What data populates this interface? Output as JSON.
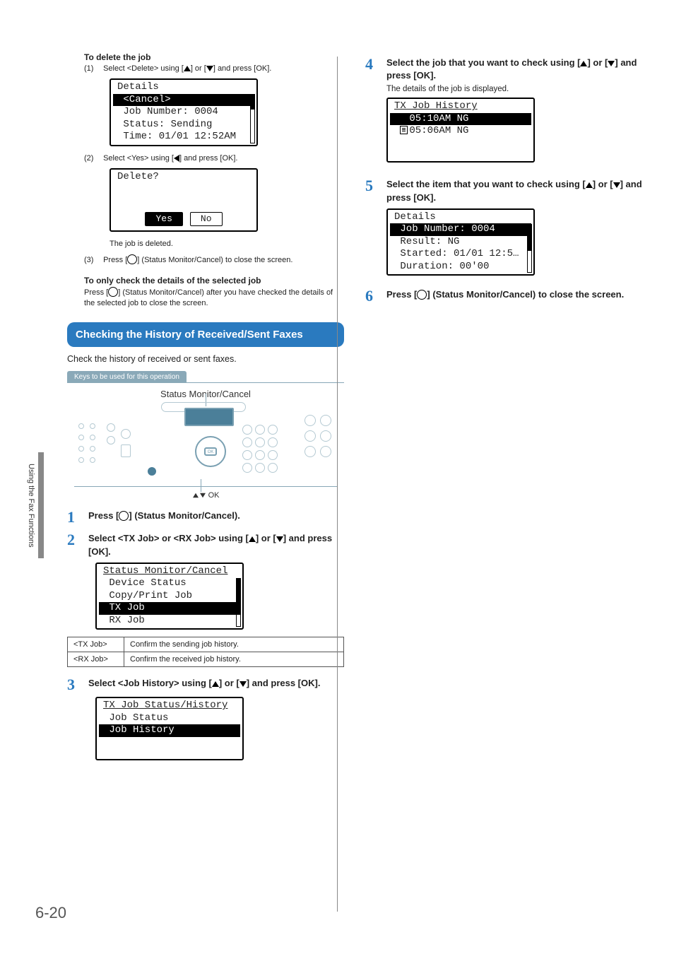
{
  "side_tab": "Using the Fax Functions",
  "page_number": "6-20",
  "left": {
    "delete_heading": "To delete the job",
    "step1_num": "(1)",
    "step1_text_a": "Select <Delete> using [",
    "step1_text_b": "] or [",
    "step1_text_c": "]  and press [OK].",
    "lcd1": {
      "r0": "Details",
      "r1": " <Cancel>",
      "r2": " Job Number: 0004",
      "r3": " Status: Sending",
      "r4": " Time: 01/01 12:52AM"
    },
    "step2_num": "(2)",
    "step2_text_a": "Select <Yes> using [",
    "step2_text_b": "]  and press [OK].",
    "dlg_title": "Delete?",
    "dlg_yes": "Yes",
    "dlg_no": "No",
    "job_deleted": "The job is deleted.",
    "step3_num": "(3)",
    "step3_text_a": "Press [",
    "step3_text_b": "] (Status Monitor/Cancel) to close the screen.",
    "only_check_heading": "To only check the details of the selected job",
    "only_check_body_a": "Press [",
    "only_check_body_b": "] (Status Monitor/Cancel) after you have checked the details of the selected job to close the screen.",
    "section_title": "Checking the History of Received/Sent Faxes",
    "section_note": "Check the history of received or sent faxes.",
    "keys_tag": "Keys to be used for this operation",
    "keys_title": "Status Monitor/Cancel",
    "keys_sub": "OK",
    "s1_a": "Press [",
    "s1_b": "] (Status Monitor/Cancel).",
    "s2_a": "Select <TX Job> or <RX Job> using [",
    "s2_b": "] or [",
    "s2_c": "] and press [OK].",
    "lcd_sm": {
      "r0": "Status Monitor/Cancel",
      "r1": " Device Status",
      "r2": " Copy/Print Job",
      "r3": " TX Job",
      "r4": " RX Job"
    },
    "table": {
      "r1c1": "<TX Job>",
      "r1c2": "Confirm the sending job history.",
      "r2c1": "<RX Job>",
      "r2c2": "Confirm the received job history."
    },
    "s3_a": "Select <Job History> using [",
    "s3_b": "] or [",
    "s3_c": "] and press [OK].",
    "lcd_hist": {
      "r0": "TX Job Status/History",
      "r1": " Job Status",
      "r2": " Job History"
    }
  },
  "right": {
    "s4_a": "Select the job that you want to check using [",
    "s4_b": "] or [",
    "s4_c": "] and press [OK].",
    "s4_note": "The details of the job is displayed.",
    "lcd_jobhist": {
      "r0": "TX Job History",
      "r1": "05:10AM NG",
      "r2": "05:06AM NG"
    },
    "s5_a": "Select the item that you want to check using [",
    "s5_b": "] or [",
    "s5_c": "] and press [OK].",
    "lcd_detail": {
      "r0": "Details",
      "r1": " Job Number: 0004",
      "r2": " Result: NG",
      "r3": " Started: 01/01 12:5…",
      "r4": " Duration: 00'00"
    },
    "s6_a": "Press [",
    "s6_b": "] (Status Monitor/Cancel) to close the screen."
  }
}
